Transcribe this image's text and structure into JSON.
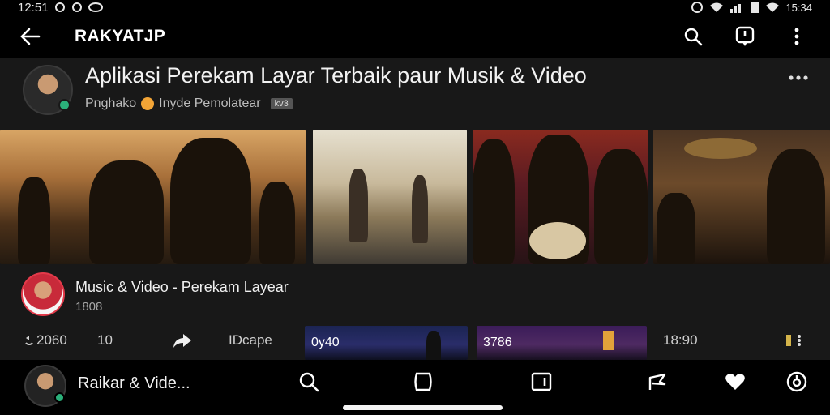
{
  "status_bar": {
    "left_text": "12:51",
    "right_text": "15:34",
    "icons": [
      "alarm-icon",
      "wifi-icon",
      "signal-icon",
      "battery-icon"
    ]
  },
  "app_bar": {
    "title": "RAKYATJP",
    "icons": [
      "back-arrow-icon",
      "search-icon",
      "notification-icon",
      "more-vert-icon"
    ]
  },
  "header": {
    "title": "Aplikasi Perekam Layar Terbaik paur Musik & Video",
    "subtitle": "Pnghako",
    "subtitle_rest": "Inyde Pemolatear",
    "tag": "kv3"
  },
  "thumbnails": [
    {
      "label": "stage-performance"
    },
    {
      "label": "guitarists-silhouette"
    },
    {
      "label": "band-concert"
    },
    {
      "label": "drummer-lounge"
    }
  ],
  "info_row": {
    "title": "Music & Video - Perekam Layear",
    "subtitle": "1808"
  },
  "stats_row": {
    "views": "2060",
    "count": "10",
    "share_label": "",
    "action_label": "IDcape",
    "mini1_label": "0y40",
    "mini2_label": "3786",
    "time_label": "18:90"
  },
  "bottom_bar": {
    "title": "Raikar & Vide...",
    "icons": [
      "search-icon",
      "home-icon",
      "library-icon",
      "share-icon",
      "heart-icon",
      "profile-icon"
    ]
  },
  "colors": {
    "background": "#000000",
    "panel": "#181818",
    "accent_green": "#2bb07a",
    "accent_red": "#e33a4a"
  }
}
